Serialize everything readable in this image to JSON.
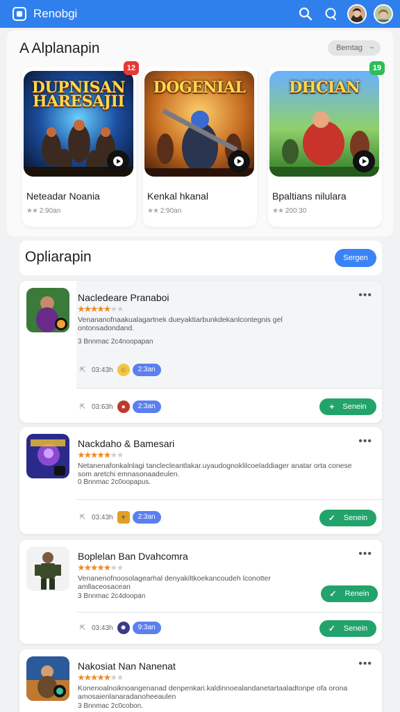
{
  "app": {
    "title": "Renobgi"
  },
  "featured": {
    "title": "A Alplanapin",
    "chip": "Bemtag",
    "cards": [
      {
        "art_title": "DUPNISAN HARESAJII",
        "art_sub": "",
        "badge": "12",
        "badge_color": "#e53935",
        "name": "Neteadar Noania",
        "stars": "★★",
        "meta": "2:90an"
      },
      {
        "art_title": "DOGENIAL",
        "art_sub": "",
        "badge": "",
        "badge_color": "",
        "name": "Kenkal hkanal",
        "stars": "★★",
        "meta": "2:90an"
      },
      {
        "art_title": "DHCIAN",
        "art_sub": "",
        "badge": "19",
        "badge_color": "#2ebd59",
        "name": "Bpaltians nilulara",
        "stars": "★★",
        "meta": "200:30"
      }
    ]
  },
  "list": {
    "title": "Opliarapin",
    "button": "Sergen",
    "items": [
      {
        "title": "Nacledeare Pranaboi",
        "stars_on": "★★★★★",
        "stars_off": "★★",
        "desc": "Venananofnaakualagartnek dueyaktiarbunkdekanlcontegnis gel ontonsadondand.",
        "info": "3 Bnnmac 2c4noopapan",
        "time1": "03:43h",
        "pill1": "2:3an",
        "time2": "03:63h",
        "pill2": "2:3an",
        "action": "Senein"
      },
      {
        "title": "Nackdaho & Bamesari",
        "stars_on": "★★★★★",
        "stars_off": "★★",
        "desc": "Netanenafonkalnlagi tanclecleantlakar.uyaudognoklilcoeladdiager anatar orta conese som aretchi emnasonaadeulen.",
        "info": "0 Bnnmac 2c0oopapus.",
        "time1": "03:43h",
        "pill1": "2:3an",
        "action": "Senein"
      },
      {
        "title": "Boplelan Ban Dvahcomra",
        "stars_on": "★★★★★",
        "stars_off": "★★",
        "desc": "Venanenofnoosolagearhal denyakiltkoekancoudeh lconotter amllaceosacean",
        "info": "3 Bnnmac 2c4doopan",
        "time1": "03:43h",
        "pill1": "9:3an",
        "action": "Renein",
        "action2": "Senein"
      },
      {
        "title": "Nakosiat Nan Nanenat",
        "stars_on": "★★★★★",
        "stars_off": "★★",
        "desc": "Konenoalnoiknoangenanad denpenkari.kaldinnoealandanetartaaladtonpe ofa orona amosaienlanaradanoheeaulen",
        "info": "3 Bnnmac 2c0cobon."
      }
    ]
  },
  "colors": {
    "accent": "#2f80ed",
    "green": "#22a36b",
    "star": "#f08a24"
  },
  "icons": [
    "search-icon",
    "chat-icon",
    "play-icon",
    "more-icon",
    "share-icon",
    "check-icon"
  ]
}
